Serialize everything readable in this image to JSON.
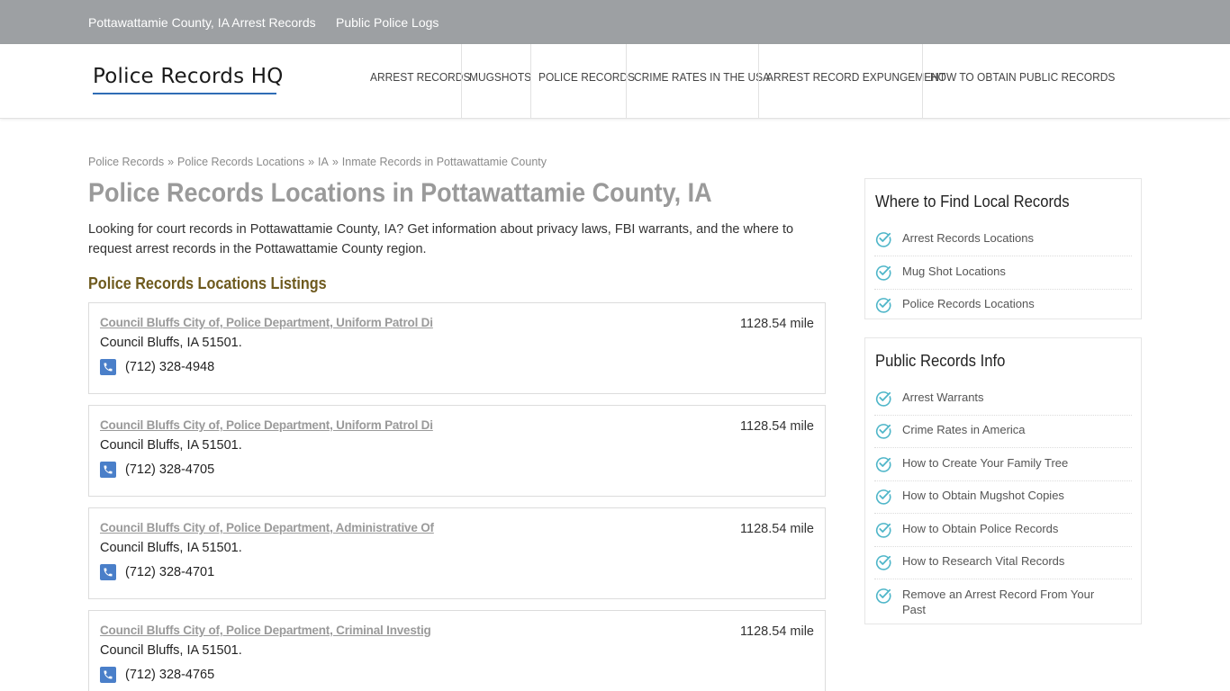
{
  "topbar": {
    "links": [
      {
        "label": "Pottawattamie County, IA Arrest Records"
      },
      {
        "label": "Public Police Logs"
      }
    ]
  },
  "header": {
    "logo_text": "Police Records HQ",
    "nav": [
      {
        "label": "ARREST RECORDS"
      },
      {
        "label": "MUGSHOTS"
      },
      {
        "label": "POLICE RECORDS"
      },
      {
        "label": "CRIME RATES IN THE USA"
      },
      {
        "label": "ARREST RECORD EXPUNGEMENT"
      },
      {
        "label": "HOW TO OBTAIN PUBLIC RECORDS"
      }
    ]
  },
  "breadcrumb": {
    "items": [
      "Police Records",
      "Police Records Locations",
      "IA",
      "Inmate Records in Pottawattamie County"
    ],
    "separator": "»"
  },
  "main": {
    "title": "Police Records Locations in Pottawattamie County, IA",
    "intro": "Looking for court records in Pottawattamie County, IA? Get information about privacy laws, FBI warrants, and the where to request arrest records in the Pottawattamie County region.",
    "section_title": "Police Records Locations Listings",
    "listings": [
      {
        "name": "Council Bluffs City of, Police Department, Uniform Patrol Di",
        "distance": "1128.54 mile",
        "address": "Council Bluffs, IA 51501.",
        "phone": "(712) 328-4948"
      },
      {
        "name": "Council Bluffs City of, Police Department, Uniform Patrol Di",
        "distance": "1128.54 mile",
        "address": "Council Bluffs, IA 51501.",
        "phone": "(712) 328-4705"
      },
      {
        "name": "Council Bluffs City of, Police Department, Administrative Of",
        "distance": "1128.54 mile",
        "address": "Council Bluffs, IA 51501.",
        "phone": "(712) 328-4701"
      },
      {
        "name": "Council Bluffs City of, Police Department, Criminal Investig",
        "distance": "1128.54 mile",
        "address": "Council Bluffs, IA 51501.",
        "phone": "(712) 328-4765"
      }
    ]
  },
  "sidebar": {
    "widgets": [
      {
        "title": "Where to Find Local Records",
        "items": [
          "Arrest Records Locations",
          "Mug Shot Locations",
          "Police Records Locations"
        ]
      },
      {
        "title": "Public Records Info",
        "items": [
          "Arrest Warrants",
          "Crime Rates in America",
          "How to Create Your Family Tree",
          "How to Obtain Mugshot Copies",
          "How to Obtain Police Records",
          "How to Research Vital Records",
          "Remove an Arrest Record From Your Past"
        ]
      }
    ]
  },
  "colors": {
    "topbar_bg": "#9da0a3",
    "logo_underline": "#2f6db5",
    "section_title": "#6e5a1e",
    "phone_icon_bg": "#4a7fc9",
    "check_icon": "#4fb6c9"
  },
  "icons": {
    "phone": "phone-icon",
    "check": "check-circle-icon"
  }
}
